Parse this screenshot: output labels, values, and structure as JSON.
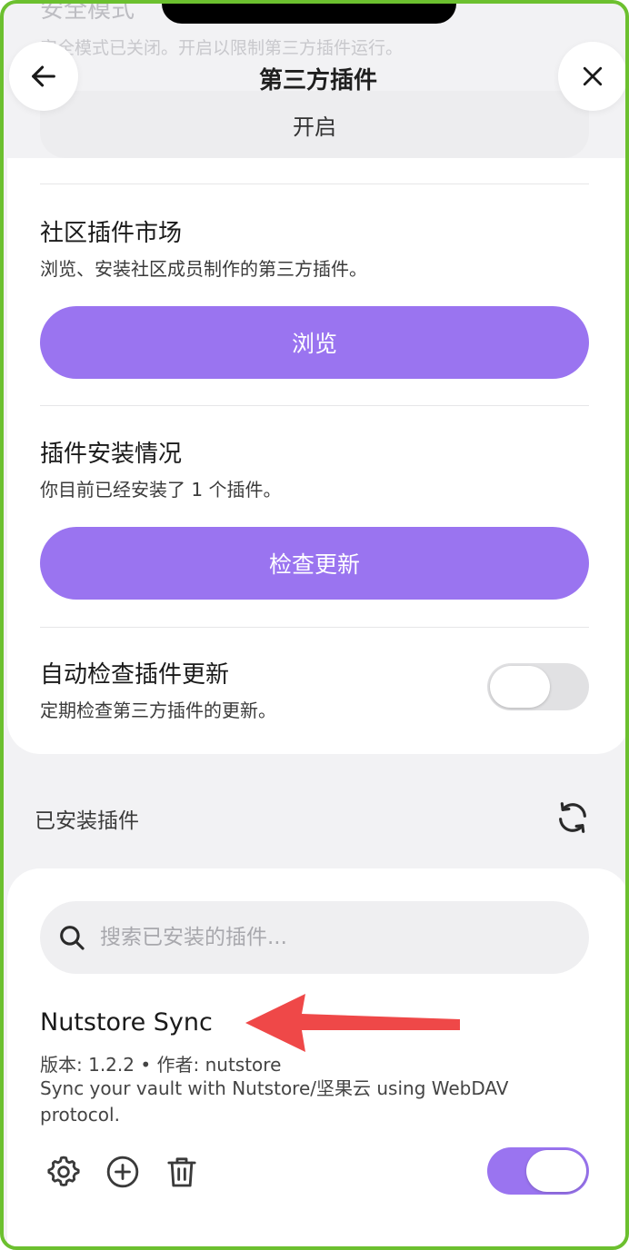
{
  "header": {
    "faded_mode_title": "安全模式",
    "faded_mode_desc": "安全模式已关闭。开启以限制第三方插件运行。",
    "title": "第三方插件",
    "enable_label": "开启"
  },
  "community": {
    "title": "社区插件市场",
    "desc": "浏览、安装社区成员制作的第三方插件。",
    "browse_label": "浏览"
  },
  "install_status": {
    "title": "插件安装情况",
    "desc": "你目前已经安装了 1 个插件。",
    "check_label": "检查更新"
  },
  "auto_check": {
    "title": "自动检查插件更新",
    "desc": "定期检查第三方插件的更新。",
    "enabled": false
  },
  "installed": {
    "header": "已安装插件",
    "search_placeholder": "搜索已安装的插件...",
    "plugins": [
      {
        "name": "Nutstore Sync",
        "meta": "版本: 1.2.2 • 作者: nutstore",
        "desc": "Sync your vault with Nutstore/坚果云 using WebDAV protocol.",
        "enabled": true
      }
    ]
  },
  "icons": {
    "back": "arrow-left-icon",
    "close": "close-icon",
    "refresh": "refresh-icon",
    "search": "search-icon",
    "settings": "gear-icon",
    "add": "plus-circle-icon",
    "delete": "trash-icon"
  },
  "colors": {
    "accent": "#9a74f0",
    "frame": "#6cc02f",
    "arrow": "#ef4848"
  }
}
